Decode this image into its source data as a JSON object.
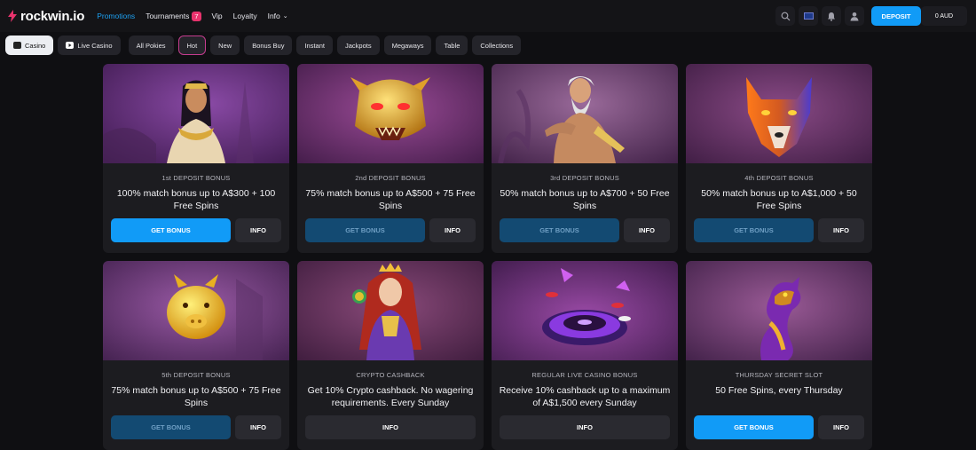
{
  "header": {
    "brand": "rockwin.io",
    "nav": [
      {
        "label": "Promotions",
        "active": true
      },
      {
        "label": "Tournaments",
        "badge": "7"
      },
      {
        "label": "Vip"
      },
      {
        "label": "Loyalty"
      },
      {
        "label": "Info",
        "has_dropdown": true
      }
    ],
    "icons": [
      "search-icon",
      "flag-icon",
      "bell-icon",
      "user-icon"
    ],
    "deposit_label": "DEPOSIT",
    "balance": "0 AUD",
    "accent": "#119bf7"
  },
  "categories": [
    {
      "label": "Casino",
      "selected": true,
      "icon": "casino-icon"
    },
    {
      "label": "Live Casino",
      "icon": "live-play-icon"
    },
    {
      "label": "All Pokies"
    },
    {
      "label": "Hot",
      "highlight": true
    },
    {
      "label": "New"
    },
    {
      "label": "Bonus Buy"
    },
    {
      "label": "Instant"
    },
    {
      "label": "Jackpots"
    },
    {
      "label": "Megaways"
    },
    {
      "label": "Table"
    },
    {
      "label": "Collections"
    }
  ],
  "promos": [
    {
      "title": "1st DEPOSIT BONUS",
      "desc": "100% match bonus up to A$300 + 100 Free Spins",
      "get_bonus": "GET BONUS",
      "bonus_state": "active",
      "info": "INFO",
      "art": "cleopatra"
    },
    {
      "title": "2nd DEPOSIT BONUS",
      "desc": "75% match bonus up to A$500 + 75 Free Spins",
      "get_bonus": "GET BONUS",
      "bonus_state": "disabled",
      "info": "INFO",
      "art": "dragon-mask"
    },
    {
      "title": "3rd DEPOSIT BONUS",
      "desc": "50% match bonus up to A$700 + 50 Free Spins",
      "get_bonus": "GET BONUS",
      "bonus_state": "disabled",
      "info": "INFO",
      "art": "zeus"
    },
    {
      "title": "4th DEPOSIT BONUS",
      "desc": "50% match bonus up to A$1,000 + 50 Free Spins",
      "get_bonus": "GET BONUS",
      "bonus_state": "disabled",
      "info": "INFO",
      "art": "wolf"
    },
    {
      "title": "5th DEPOSIT BONUS",
      "desc": "75% match bonus up to A$500 + 75 Free Spins",
      "get_bonus": "GET BONUS",
      "bonus_state": "disabled",
      "info": "INFO",
      "art": "piggy-bank"
    },
    {
      "title": "CRYPTO CASHBACK",
      "desc": "Get 10% Crypto cashback. No wagering requirements. Every Sunday",
      "info": "INFO",
      "art": "queen"
    },
    {
      "title": "REGULAR LIVE CASINO BONUS",
      "desc": "Receive 10% cashback up to a maximum of A$1,500 every Sunday",
      "info": "INFO",
      "art": "roulette"
    },
    {
      "title": "THURSDAY SECRET SLOT",
      "desc": "50 Free Spins, every Thursday",
      "get_bonus": "GET BONUS",
      "bonus_state": "active",
      "info": "INFO",
      "art": "purple-dragon"
    }
  ]
}
